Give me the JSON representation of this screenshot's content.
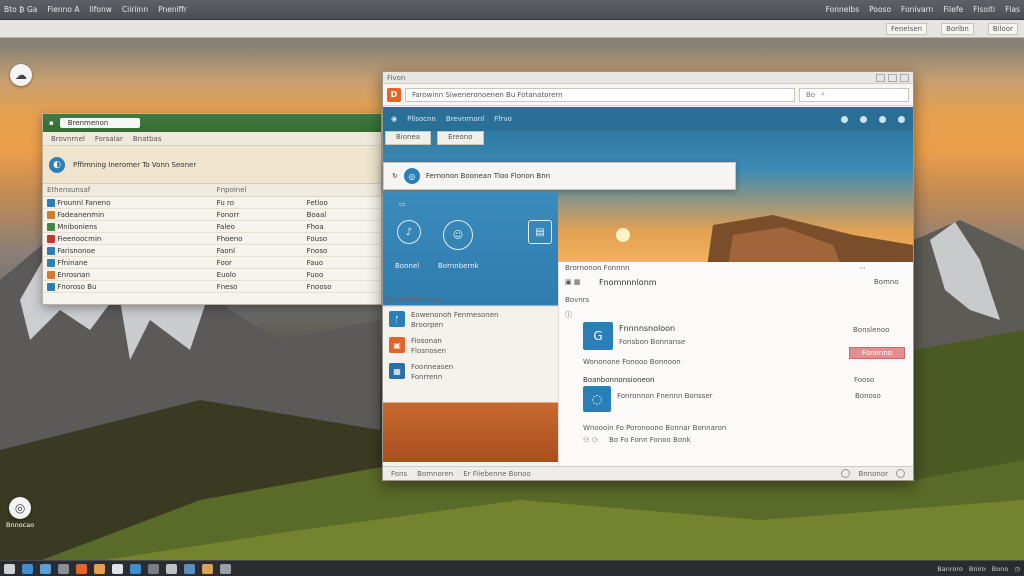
{
  "topbar": {
    "items": [
      "Bto ₿ Ga",
      "Fienno A",
      "Ilfonw",
      "Ciiriinn",
      "Pneniffr"
    ],
    "right": [
      "Fonnelbs",
      "Pooso",
      "Fonivarn",
      "Filefe",
      "Flsoiti",
      "Flas"
    ]
  },
  "menurow": {
    "right": [
      "Fenelsen",
      "Borlbn",
      "Biloor"
    ]
  },
  "desktop": {
    "icon_label": "Bnnocao"
  },
  "left_window": {
    "address": "Brenmenon",
    "tabs": [
      "Brovnrnel",
      "Forsalar",
      "Bnatbas"
    ],
    "header_text": "Pffimning  Ineromer To Vonn Seoner",
    "columns": [
      "Ethensunsaf",
      "Fnpoinel"
    ],
    "rows": [
      [
        "Frounnl Faneno",
        "Fu ro",
        "Fetloo"
      ],
      [
        "Fadeanenmin",
        "Fonorr",
        "Boaal"
      ],
      [
        "Mniboniens",
        "Faleo",
        "Fhoa"
      ],
      [
        "Fieenoocmin",
        "Fhoeno",
        "Fouso"
      ],
      [
        "Farisnonoe",
        "Faonl",
        "Fnoso"
      ],
      [
        "Ffninane",
        "Foor",
        "Fauo"
      ],
      [
        "Enrosnan",
        "Euolo",
        "Fuoo"
      ],
      [
        "Fnoroso Bu",
        "Fneso",
        "Fnooso"
      ]
    ]
  },
  "main_window": {
    "title": "Fivon",
    "url": "Farowinn Siweneronoenen Bu Fotanatorern",
    "search_label": "Bo",
    "hero_bar": [
      "Pllsocnn",
      "Brevnrnonl",
      "Ffrvo"
    ],
    "tabs": [
      "Bionea",
      "Ereono"
    ],
    "popup_text": "Fernonon Boonean Tloo Flonon Bnn",
    "sidebar": {
      "label_a": "Bonnel",
      "label_b": "Bornnbernk",
      "list_header": "Brmnssfonnons",
      "items": [
        {
          "title": "Eowenonoh Fenmesonen",
          "sub": "Broorpen"
        },
        {
          "title": "Fiosonan",
          "sub": "Flosnosen"
        },
        {
          "title": "Foonneasen",
          "sub": "Fonrrenn"
        }
      ]
    },
    "content": {
      "bar": "Brornonon Fonnnn",
      "heading": "Fnomnnnlonm",
      "badge": "Bomno",
      "sub_heading": "Bovnrs",
      "card_title": "Fnnnnsnoloon",
      "card_sub": "Fonsbon Bonnanse",
      "card_meta": "Wononone Fonooo Bonnoon",
      "right_label": "Bonslenoo",
      "pink_button": "Fonenno",
      "section_title": "Boanbonnonsioneon",
      "section_right": "Fooso",
      "card2_title": "Fonronnon Fnennn Bonsser",
      "card2_right": "Bonoso",
      "footer_text": "Wnoooin Fo Poronoono Bonnar Bonnaron",
      "footer_tags": "Bo Fo  Fonn Fonoo Bonk"
    },
    "status": {
      "left": [
        "Fons",
        "Bomnoren",
        "Er Fiiebenne Bonoo"
      ],
      "right": "Bnnonor"
    }
  },
  "taskbar": {
    "tray": [
      "Banroro",
      "Bniro",
      "Bono"
    ]
  },
  "colors": {
    "accent_blue": "#2a7fb8",
    "title_green": "#3f7b3e",
    "badge_orange": "#e5642a",
    "button_pink": "#e88d8f"
  }
}
